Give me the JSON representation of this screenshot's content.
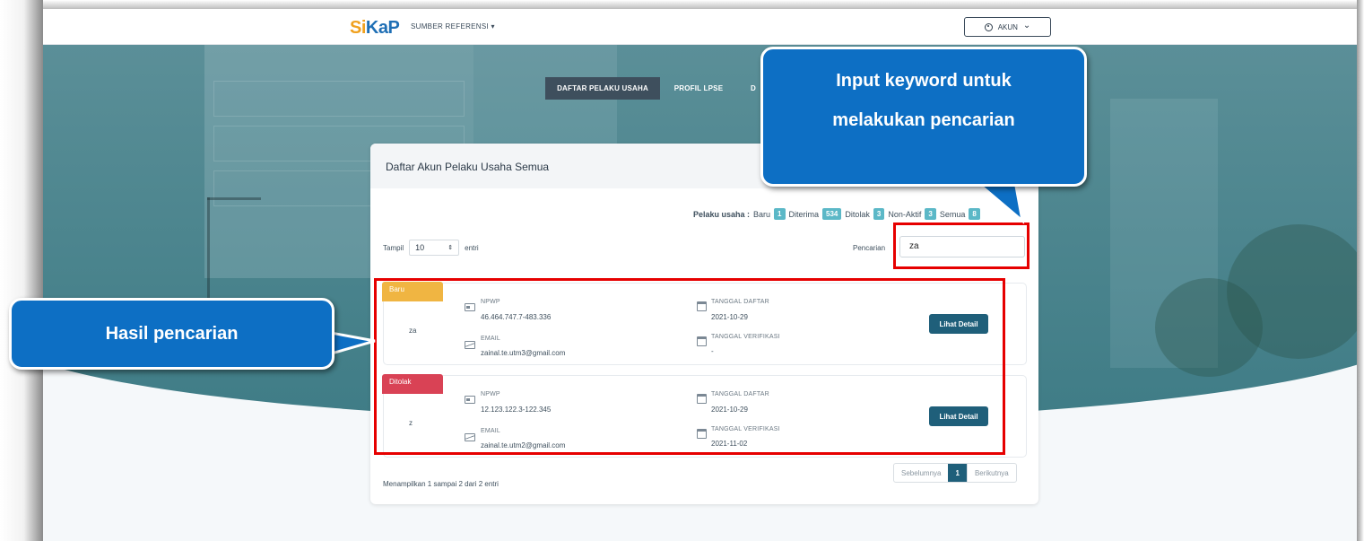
{
  "nav": {
    "logo_part1": "Si",
    "logo_part2": "KaP",
    "menu_label": "SUMBER REFERENSI ▾",
    "account_label": "AKUN",
    "account_chevron": "⌄"
  },
  "tabs": [
    {
      "label": "DAFTAR PELAKU USAHA",
      "active": true
    },
    {
      "label": "PROFIL LPSE",
      "active": false
    },
    {
      "label": "D",
      "active": false
    }
  ],
  "card": {
    "title": "Daftar Akun Pelaku Usaha Semua",
    "stats": {
      "label": "Pelaku usaha :",
      "items": [
        {
          "label": "Baru",
          "count": "1"
        },
        {
          "label": "Diterima",
          "count": "534"
        },
        {
          "label": "Ditolak",
          "count": "3"
        },
        {
          "label": "Non-Aktif",
          "count": "3"
        },
        {
          "label": "Semua",
          "count": "8"
        }
      ]
    },
    "tampil_label": "Tampil",
    "tampil_value": "10",
    "entri_label": "entri",
    "search_label": "Pencarian",
    "search_value": "za",
    "results": [
      {
        "status": "Baru",
        "name": "za",
        "npwp_label": "NPWP",
        "npwp": "46.464.747.7-483.336",
        "email_label": "EMAIL",
        "email": "zainal.te.utm3@gmail.com",
        "tgl_daftar_label": "TANGGAL DAFTAR",
        "tgl_daftar": "2021-10-29",
        "tgl_verif_label": "TANGGAL VERIFIKASI",
        "tgl_verif": "-",
        "button": "Lihat Detail"
      },
      {
        "status": "Ditolak",
        "name": "z",
        "npwp_label": "NPWP",
        "npwp": "12.123.122.3-122.345",
        "email_label": "EMAIL",
        "email": "zainal.te.utm2@gmail.com",
        "tgl_daftar_label": "TANGGAL DAFTAR",
        "tgl_daftar": "2021-10-29",
        "tgl_verif_label": "TANGGAL VERIFIKASI",
        "tgl_verif": "2021-11-02",
        "button": "Lihat Detail"
      }
    ],
    "footer_info": "Menampilkan 1 sampai 2 dari 2 entri",
    "pager": {
      "prev": "Sebelumnya",
      "current": "1",
      "next": "Berikutnya"
    }
  },
  "annotations": {
    "top_line1": "Input keyword untuk",
    "top_line2": "melakukan pencarian",
    "left": "Hasil pencarian",
    "callout_color": "#0d6fc4",
    "highlight_color": "#e60000"
  }
}
